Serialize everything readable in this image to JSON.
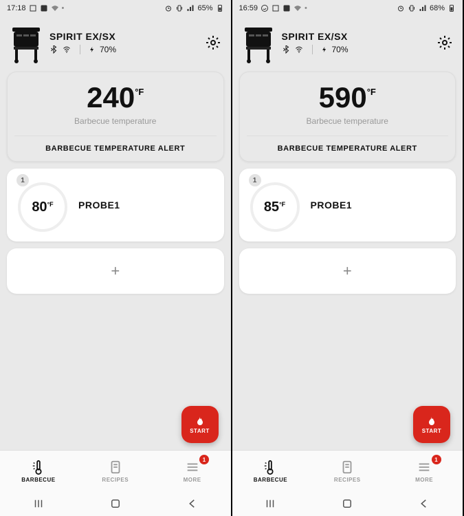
{
  "screens": [
    {
      "statusbar": {
        "time": "17:18",
        "battery_pct": "65%"
      },
      "device": {
        "name": "SPIRIT EX/SX",
        "battery": "70%"
      },
      "bbq_temp": {
        "value": "240",
        "unit": "°F",
        "label": "Barbecue temperature",
        "alert": "BARBECUE TEMPERATURE ALERT"
      },
      "probe": {
        "num": "1",
        "value": "80",
        "unit": "°F",
        "name": "PROBE1"
      },
      "fab": "START",
      "tabs": [
        "BARBECUE",
        "RECIPES",
        "MORE"
      ],
      "more_badge": "1"
    },
    {
      "statusbar": {
        "time": "16:59",
        "battery_pct": "68%"
      },
      "device": {
        "name": "SPIRIT EX/SX",
        "battery": "70%"
      },
      "bbq_temp": {
        "value": "590",
        "unit": "°F",
        "label": "Barbecue temperature",
        "alert": "BARBECUE TEMPERATURE ALERT"
      },
      "probe": {
        "num": "1",
        "value": "85",
        "unit": "°F",
        "name": "PROBE1"
      },
      "fab": "START",
      "tabs": [
        "BARBECUE",
        "RECIPES",
        "MORE"
      ],
      "more_badge": "1"
    }
  ],
  "icons": {
    "plus": "+"
  }
}
